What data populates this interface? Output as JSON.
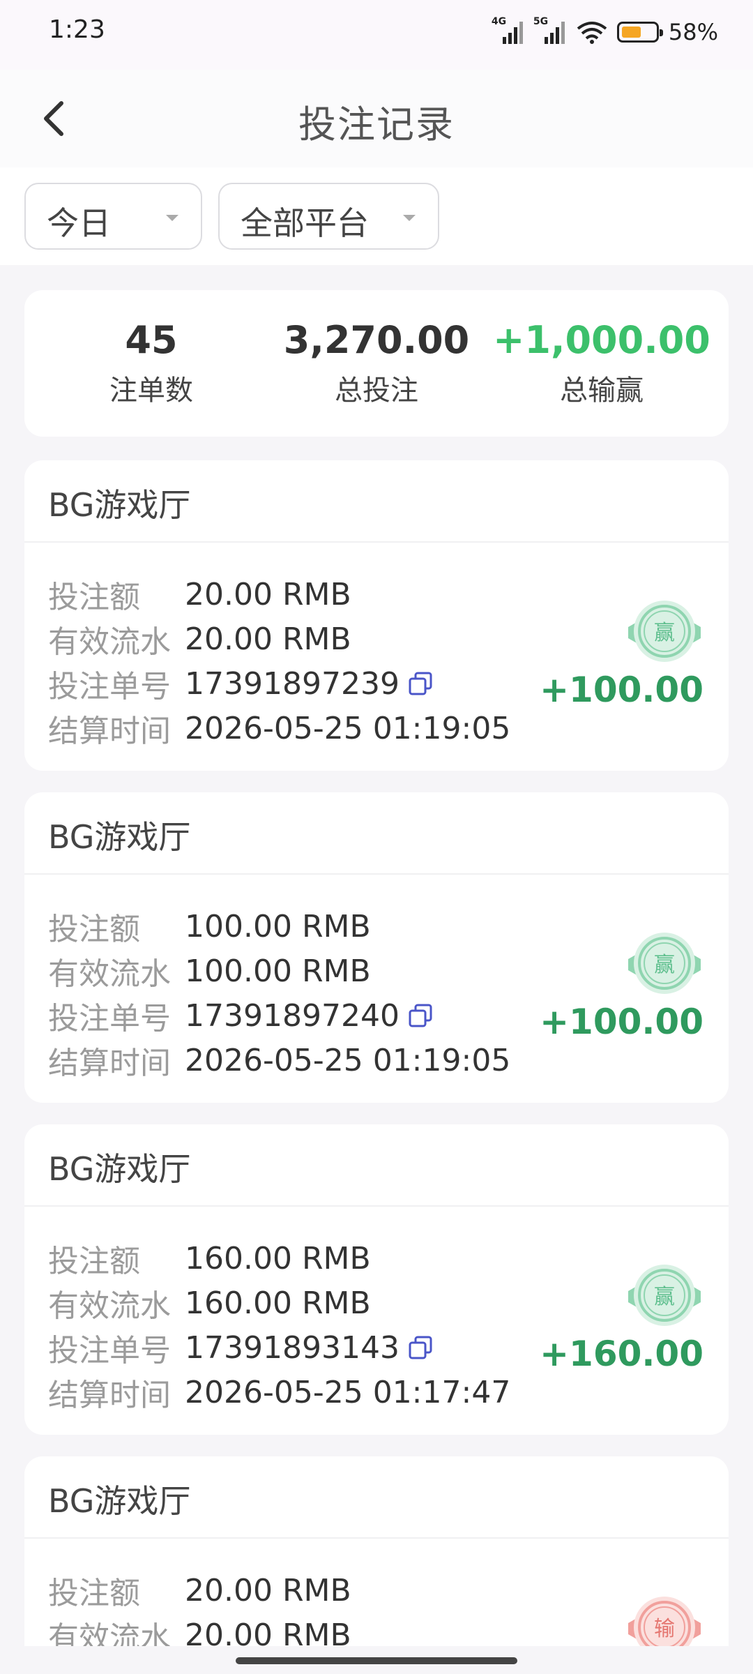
{
  "status_bar": {
    "time": "1:23",
    "signal1_label": "4G",
    "signal2_label": "5G",
    "battery_percent": "58%",
    "battery_level": 0.58,
    "battery_color": "#f5a623"
  },
  "header": {
    "back_icon": "chevron-left-icon",
    "title": "投注记录"
  },
  "filters": {
    "date": {
      "selected": "今日",
      "icon": "caret-down-icon"
    },
    "platform": {
      "selected": "全部平台",
      "icon": "caret-down-icon"
    }
  },
  "summary": {
    "count_value": "45",
    "count_label": "注单数",
    "bet_value": "3,270.00",
    "bet_label": "总投注",
    "winloss_value": "+1,000.00",
    "winloss_label": "总输赢",
    "win_color": "#3cc06b"
  },
  "labels": {
    "bet_amount": "投注额",
    "turnover": "有效流水",
    "order_no": "投注单号",
    "settle_time": "结算时间"
  },
  "records": [
    {
      "venue": "BG游戏厅",
      "bet_amount": "20.00 RMB",
      "turnover": "20.00 RMB",
      "order_no": "17391897239",
      "settle_time": "2026-05-25 01:19:05",
      "stamp_text": "赢",
      "result": "+100.00"
    },
    {
      "venue": "BG游戏厅",
      "bet_amount": "100.00 RMB",
      "turnover": "100.00 RMB",
      "order_no": "17391897240",
      "settle_time": "2026-05-25 01:19:05",
      "stamp_text": "赢",
      "result": "+100.00"
    },
    {
      "venue": "BG游戏厅",
      "bet_amount": "160.00 RMB",
      "turnover": "160.00 RMB",
      "order_no": "17391893143",
      "settle_time": "2026-05-25 01:17:47",
      "stamp_text": "赢",
      "result": "+160.00"
    },
    {
      "venue": "BG游戏厅",
      "bet_amount": "20.00 RMB",
      "turnover": "20.00 RMB",
      "stamp_text": "输"
    }
  ]
}
